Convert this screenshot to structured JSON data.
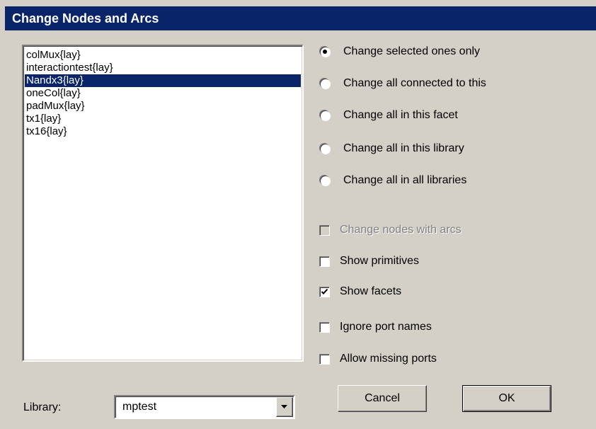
{
  "window": {
    "title": "Change Nodes and Arcs"
  },
  "facet_list": {
    "items": [
      {
        "label": "colMux{lay}",
        "selected": false
      },
      {
        "label": "interactiontest{lay}",
        "selected": false
      },
      {
        "label": "Nandx3{lay}",
        "selected": true
      },
      {
        "label": "oneCol{lay}",
        "selected": false
      },
      {
        "label": "padMux{lay}",
        "selected": false
      },
      {
        "label": "tx1{lay}",
        "selected": false
      },
      {
        "label": "tx16{lay}",
        "selected": false
      }
    ]
  },
  "scope_options": [
    {
      "label": "Change selected ones only",
      "checked": true
    },
    {
      "label": "Change all connected to this",
      "checked": false
    },
    {
      "label": "Change all in this facet",
      "checked": false
    },
    {
      "label": "Change all in this library",
      "checked": false
    },
    {
      "label": "Change all in all libraries",
      "checked": false
    }
  ],
  "options": [
    {
      "label": "Change nodes with arcs",
      "checked": false,
      "enabled": false
    },
    {
      "label": "Show primitives",
      "checked": false,
      "enabled": true
    },
    {
      "label": "Show facets",
      "checked": true,
      "enabled": true
    },
    {
      "label": "Ignore port names",
      "checked": false,
      "enabled": true
    },
    {
      "label": "Allow missing ports",
      "checked": false,
      "enabled": true
    }
  ],
  "library": {
    "label": "Library:",
    "value": "mptest"
  },
  "buttons": {
    "cancel": "Cancel",
    "ok": "OK"
  },
  "colors": {
    "selection": "#0a246a",
    "face": "#d4d0c8"
  }
}
